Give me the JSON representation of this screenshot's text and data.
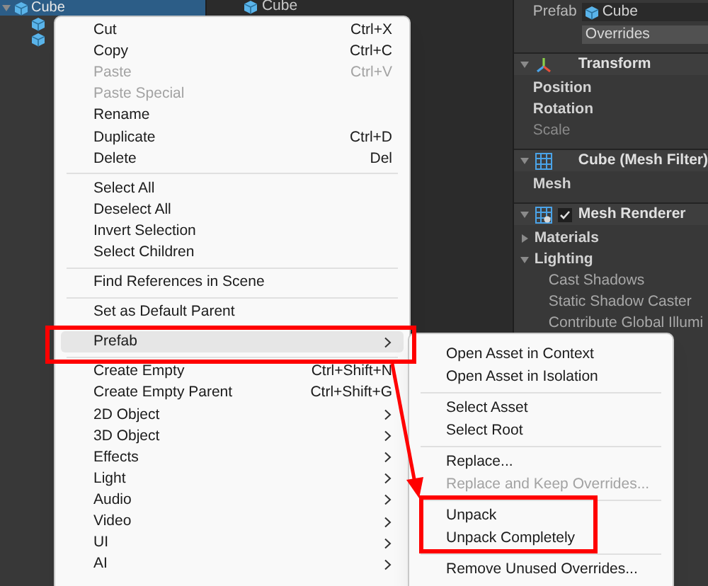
{
  "hierarchy": {
    "items": [
      {
        "label": "Cube",
        "selected": true,
        "expanded": true,
        "children": [
          {
            "selected": false
          },
          {
            "selected": false
          }
        ]
      }
    ]
  },
  "scene_list": {
    "items": [
      {
        "label": "Cube"
      }
    ]
  },
  "inspector": {
    "prefab": {
      "label": "Prefab",
      "value": "Cube",
      "button": "Overrides"
    },
    "components": [
      {
        "title": "Transform",
        "expanded": true,
        "fields": [
          {
            "kind": "property",
            "label": "Position",
            "disabled": false
          },
          {
            "kind": "property",
            "label": "Rotation",
            "disabled": false
          },
          {
            "kind": "property",
            "label": "Scale",
            "disabled": true
          }
        ]
      },
      {
        "title": "Cube (Mesh Filter)",
        "expanded": true,
        "fields": [
          {
            "kind": "property",
            "label": "Mesh",
            "disabled": false
          }
        ]
      },
      {
        "title": "Mesh Renderer",
        "checked": true,
        "expanded": true,
        "fields": [
          {
            "kind": "foldout",
            "label": "Materials",
            "expanded": false,
            "disabled": false
          },
          {
            "kind": "foldout",
            "label": "Lighting",
            "expanded": true,
            "disabled": false,
            "children": [
              {
                "label": "Cast Shadows"
              },
              {
                "label": "Static Shadow Caster"
              },
              {
                "label": "Contribute Global Illumi"
              }
            ]
          }
        ]
      }
    ]
  },
  "context_menu": {
    "items": [
      {
        "kind": "item",
        "label": "Cut",
        "shortcut": "Ctrl+X",
        "disabled": false,
        "selected": false,
        "submenu": false
      },
      {
        "kind": "item",
        "label": "Copy",
        "shortcut": "Ctrl+C",
        "disabled": false,
        "selected": false,
        "submenu": false
      },
      {
        "kind": "item",
        "label": "Paste",
        "shortcut": "Ctrl+V",
        "disabled": true,
        "selected": false,
        "submenu": false
      },
      {
        "kind": "item",
        "label": "Paste Special",
        "disabled": true,
        "selected": false,
        "submenu": false
      },
      {
        "kind": "item",
        "label": "Rename",
        "disabled": false,
        "selected": false,
        "submenu": false
      },
      {
        "kind": "item",
        "label": "Duplicate",
        "shortcut": "Ctrl+D",
        "disabled": false,
        "selected": false,
        "submenu": false
      },
      {
        "kind": "item",
        "label": "Delete",
        "shortcut": "Del",
        "disabled": false,
        "selected": false,
        "submenu": false
      },
      {
        "kind": "separator"
      },
      {
        "kind": "item",
        "label": "Select All",
        "disabled": false,
        "selected": false,
        "submenu": false
      },
      {
        "kind": "item",
        "label": "Deselect All",
        "disabled": false,
        "selected": false,
        "submenu": false
      },
      {
        "kind": "item",
        "label": "Invert Selection",
        "disabled": false,
        "selected": false,
        "submenu": false
      },
      {
        "kind": "item",
        "label": "Select Children",
        "disabled": false,
        "selected": false,
        "submenu": false
      },
      {
        "kind": "separator"
      },
      {
        "kind": "item",
        "label": "Find References in Scene",
        "disabled": false,
        "selected": false,
        "submenu": false
      },
      {
        "kind": "separator"
      },
      {
        "kind": "item",
        "label": "Set as Default Parent",
        "disabled": false,
        "selected": false,
        "submenu": false
      },
      {
        "kind": "separator"
      },
      {
        "kind": "item",
        "label": "Prefab",
        "disabled": false,
        "selected": true,
        "submenu": true
      },
      {
        "kind": "separator"
      },
      {
        "kind": "item",
        "label": "Create Empty",
        "shortcut": "Ctrl+Shift+N",
        "disabled": false,
        "selected": false,
        "submenu": false
      },
      {
        "kind": "item",
        "label": "Create Empty Parent",
        "shortcut": "Ctrl+Shift+G",
        "disabled": false,
        "selected": false,
        "submenu": false
      },
      {
        "kind": "item",
        "label": "2D Object",
        "disabled": false,
        "selected": false,
        "submenu": true
      },
      {
        "kind": "item",
        "label": "3D Object",
        "disabled": false,
        "selected": false,
        "submenu": true
      },
      {
        "kind": "item",
        "label": "Effects",
        "disabled": false,
        "selected": false,
        "submenu": true
      },
      {
        "kind": "item",
        "label": "Light",
        "disabled": false,
        "selected": false,
        "submenu": true
      },
      {
        "kind": "item",
        "label": "Audio",
        "disabled": false,
        "selected": false,
        "submenu": true
      },
      {
        "kind": "item",
        "label": "Video",
        "disabled": false,
        "selected": false,
        "submenu": true
      },
      {
        "kind": "item",
        "label": "UI",
        "disabled": false,
        "selected": false,
        "submenu": true
      },
      {
        "kind": "item",
        "label": "AI",
        "disabled": false,
        "selected": false,
        "submenu": true
      }
    ]
  },
  "submenu": {
    "items": [
      {
        "kind": "item",
        "label": "Open Asset in Context",
        "disabled": false
      },
      {
        "kind": "item",
        "label": "Open Asset in Isolation",
        "disabled": false
      },
      {
        "kind": "separator"
      },
      {
        "kind": "item",
        "label": "Select Asset",
        "disabled": false
      },
      {
        "kind": "item",
        "label": "Select Root",
        "disabled": false
      },
      {
        "kind": "separator"
      },
      {
        "kind": "item",
        "label": "Replace...",
        "disabled": false
      },
      {
        "kind": "item",
        "label": "Replace and Keep Overrides...",
        "disabled": true
      },
      {
        "kind": "separator"
      },
      {
        "kind": "item",
        "label": "Unpack",
        "disabled": false
      },
      {
        "kind": "item",
        "label": "Unpack Completely",
        "disabled": false
      },
      {
        "kind": "separator"
      },
      {
        "kind": "item",
        "label": "Remove Unused Overrides...",
        "disabled": false
      }
    ]
  }
}
